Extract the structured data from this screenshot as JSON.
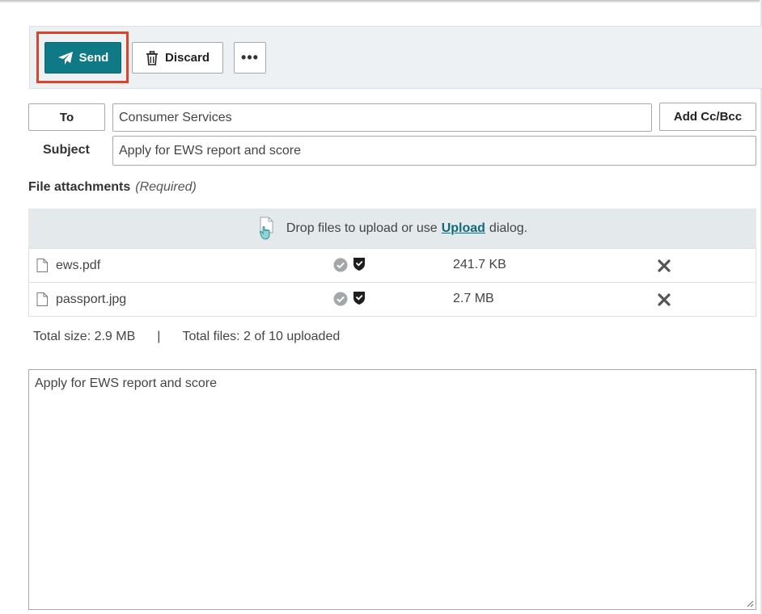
{
  "toolbar": {
    "send_label": "Send",
    "discard_label": "Discard",
    "more_label": "•••",
    "send_color": "#0f7a86",
    "highlight_color": "#d9452b"
  },
  "compose": {
    "to_button": "To",
    "to_value": "Consumer Services",
    "add_cc_bcc": "Add Cc/Bcc",
    "subject_label": "Subject",
    "subject_value": "Apply for EWS report and score"
  },
  "attachments": {
    "title": "File attachments",
    "required": "(Required)",
    "drop_text_before": "Drop files to upload or use",
    "upload_link": "Upload",
    "drop_text_after": "dialog.",
    "files": [
      {
        "name": "ews.pdf",
        "size": "241.7 KB",
        "icon": "file-icon",
        "status_icons": [
          "check-circle-icon",
          "shield-icon"
        ],
        "action_icon": "close-icon"
      },
      {
        "name": "passport.jpg",
        "size": "2.7 MB",
        "icon": "file-icon",
        "status_icons": [
          "check-circle-icon",
          "shield-icon"
        ],
        "action_icon": "close-icon"
      }
    ],
    "total_size": "Total size: 2.9 MB",
    "separator": "|",
    "total_files": "Total files: 2 of 10 uploaded"
  },
  "message": {
    "body": "Apply for EWS report and score"
  }
}
